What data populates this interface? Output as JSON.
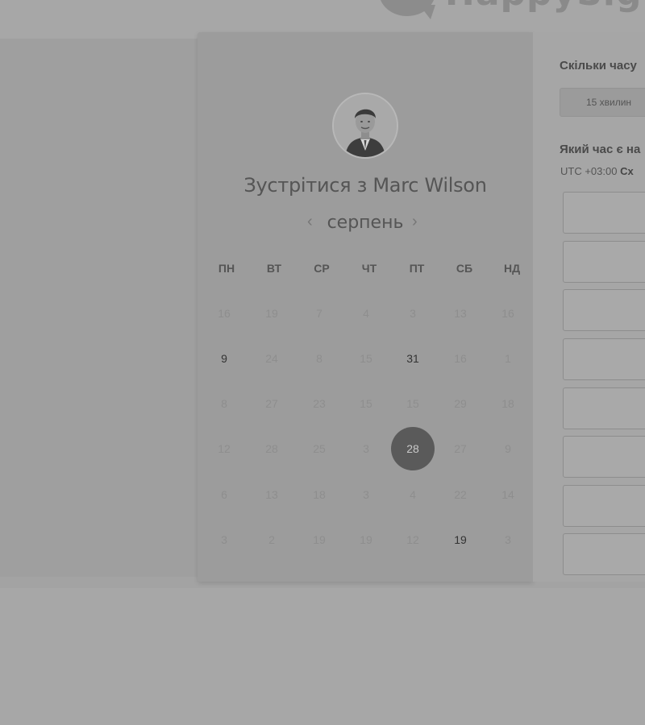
{
  "logo": {
    "text": "HappySign"
  },
  "profile": {
    "title": "Зустрітися з Marc Wilson",
    "avatar": "person-avatar"
  },
  "calendar": {
    "month": "серпень",
    "prev_icon": "chevron-left-icon",
    "next_icon": "chevron-right-icon",
    "weekdays": [
      "ПН",
      "ВТ",
      "СР",
      "ЧТ",
      "ПТ",
      "СБ",
      "НД"
    ],
    "weeks": [
      [
        "16",
        "19",
        "7",
        "4",
        "3",
        "13",
        "16"
      ],
      [
        "9",
        "24",
        "8",
        "15",
        "31",
        "16",
        "1"
      ],
      [
        "8",
        "27",
        "23",
        "15",
        "15",
        "29",
        "18"
      ],
      [
        "12",
        "28",
        "25",
        "3",
        "28",
        "27",
        "9"
      ],
      [
        "6",
        "13",
        "18",
        "3",
        "4",
        "22",
        "14"
      ],
      [
        "3",
        "2",
        "19",
        "19",
        "12",
        "19",
        "3"
      ]
    ],
    "available": [
      [
        1,
        0
      ],
      [
        1,
        4
      ],
      [
        5,
        5
      ]
    ],
    "selected": [
      3,
      4
    ]
  },
  "booking": {
    "duration_question": "Скільки часу",
    "duration_option": "15 хвилин",
    "time_question": "Який час є на",
    "timezone_offset": "UTC +03:00",
    "timezone_name": "Сх"
  },
  "colors": {
    "selected_day": "#5a5a5a"
  }
}
